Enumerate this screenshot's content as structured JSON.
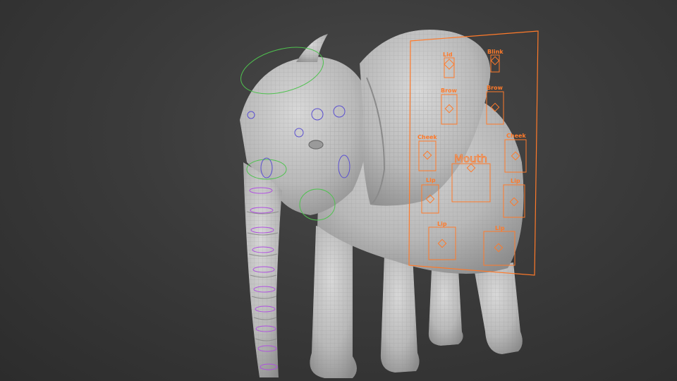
{
  "viewport": {
    "background": "#3a3a3a",
    "mesh_color": "#c9c9c9",
    "wire_color": "#8f8f8f",
    "accent_orange": "#ff7a2a",
    "accent_green": "#4fc24f",
    "accent_blue": "#5a4fd0",
    "accent_purple": "#b04fe0"
  },
  "face_rig": {
    "controls": {
      "lid_l": "Lid",
      "blink": "Blink",
      "brow_l": "Brow",
      "brow_r": "Brow",
      "cheek_l": "Cheek",
      "cheek_r": "Cheek",
      "mouth": "Mouth",
      "lip_ul": "Lip",
      "lip_ur": "Lip",
      "lip_ll": "Lip",
      "lip_lr": "Lip"
    }
  }
}
